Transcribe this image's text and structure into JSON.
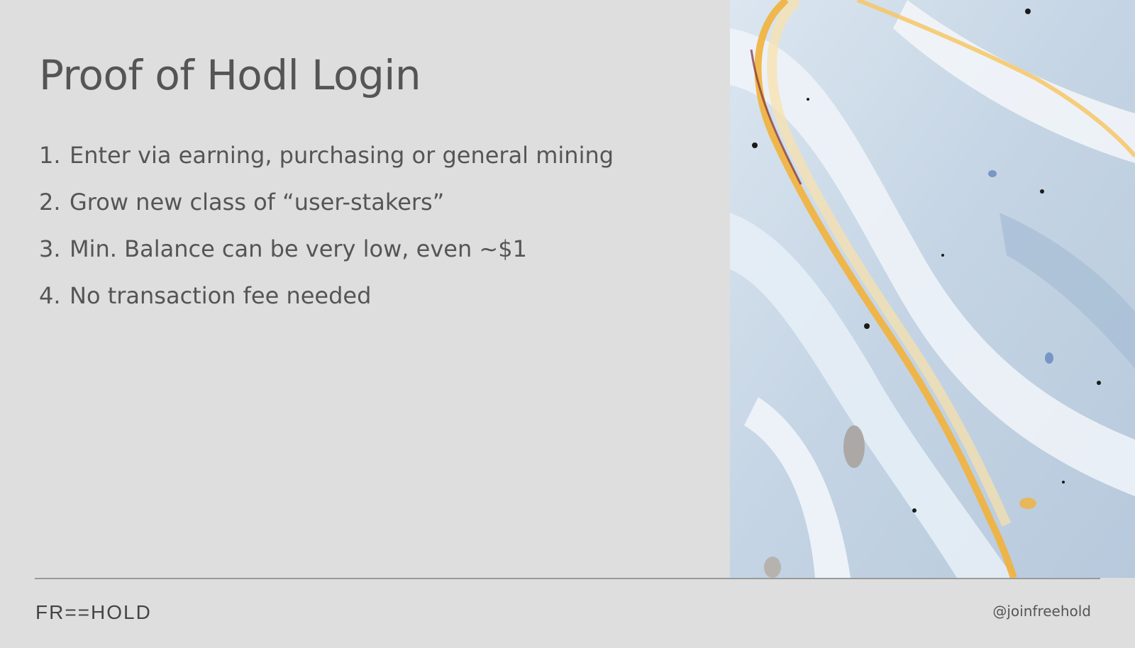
{
  "slide": {
    "title": "Proof of Hodl Login",
    "points": [
      {
        "num": "1.",
        "text": "Enter via earning, purchasing or general mining"
      },
      {
        "num": "2.",
        "text": "Grow new class of “user-stakers”"
      },
      {
        "num": "3.",
        "text": "Min. Balance can be very low, even ~$1"
      },
      {
        "num": "4.",
        "text": "No transaction fee needed"
      }
    ]
  },
  "footer": {
    "logo_text": "FR==HOLD",
    "handle": "@joinfreehold"
  },
  "colors": {
    "background": "#dedede",
    "text": "#555555",
    "rule": "#9a9a9a",
    "marble_gold": "#f2b13a",
    "marble_blue": "#a9bfd6"
  },
  "image": {
    "icon": "marble-art-image"
  }
}
